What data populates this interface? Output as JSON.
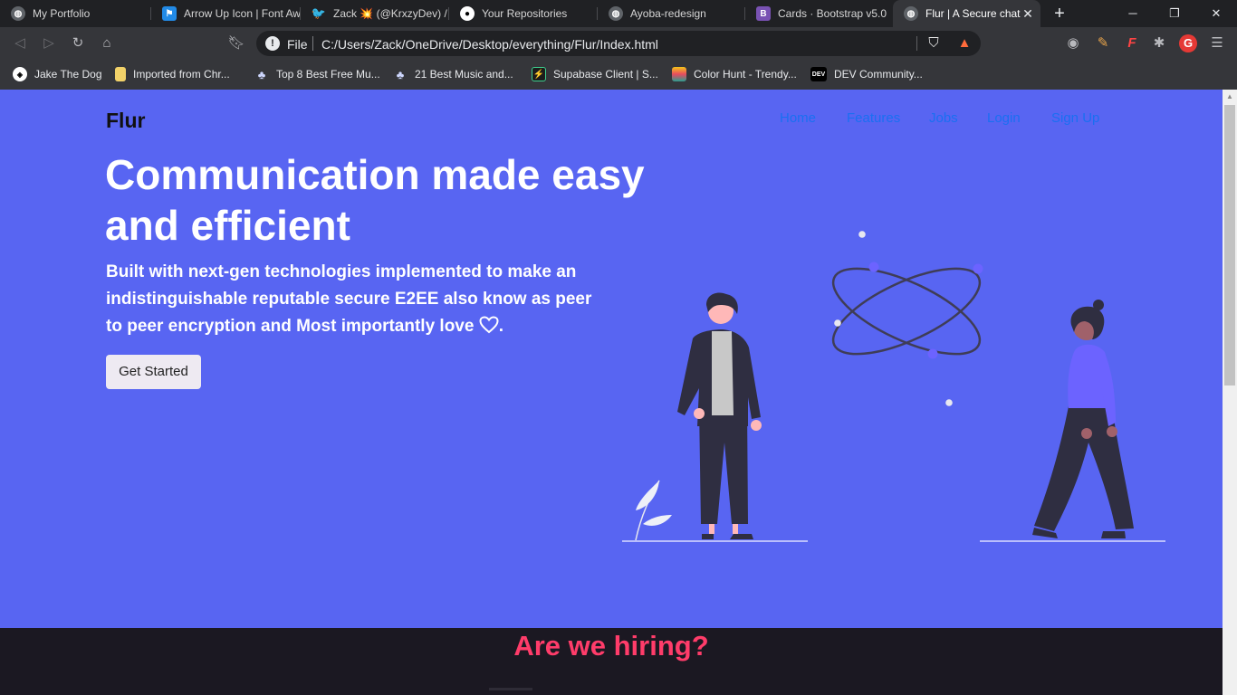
{
  "browser": {
    "tabs": [
      {
        "title": "My Portfolio",
        "icon": "globe-icon"
      },
      {
        "title": "Arrow Up Icon | Font Aw",
        "icon": "fontawesome-flag-icon"
      },
      {
        "title": "Zack 💥 (@KrxzyDev) / T",
        "icon": "twitter-icon"
      },
      {
        "title": "Your Repositories",
        "icon": "github-icon"
      },
      {
        "title": "Ayoba-redesign",
        "icon": "globe-icon"
      },
      {
        "title": "Cards · Bootstrap v5.0",
        "icon": "bootstrap-icon"
      },
      {
        "title": "Flur | A Secure chat",
        "icon": "globe-icon",
        "active": true
      }
    ],
    "omnibox": {
      "scheme_label": "File",
      "url": "C:/Users/Zack/OneDrive/Desktop/everything/Flur/Index.html"
    },
    "bookmarks": [
      {
        "label": "Jake The Dog",
        "icon": "codepen-icon"
      },
      {
        "label": "Imported from Chr...",
        "icon": "folder-icon"
      },
      {
        "label": "Top 8 Best Free Mu...",
        "icon": "octopus-icon"
      },
      {
        "label": "21 Best Music and...",
        "icon": "octopus-icon"
      },
      {
        "label": "Supabase Client | S...",
        "icon": "supabase-icon"
      },
      {
        "label": "Color Hunt - Trendy...",
        "icon": "colorhunt-icon"
      },
      {
        "label": "DEV Community...",
        "icon": "dev-icon"
      }
    ]
  },
  "page": {
    "brand": "Flur",
    "nav": [
      "Home",
      "Features",
      "Jobs",
      "Login",
      "Sign Up"
    ],
    "hero": {
      "title": "Communication made easy and efficient",
      "subtitle": "Built with next-gen technologies implemented to make an indistinguishable reputable secure E2EE also know as peer to peer encryption and Most importantly love",
      "subtitle_end": ".",
      "cta": "Get Started"
    },
    "hiring_title": "Are we hiring?"
  },
  "colors": {
    "hero_bg": "#5865f2",
    "hiring_bg": "#1b1822",
    "hiring_title": "#ff3c6a",
    "nav_link": "#1a6ff2"
  }
}
